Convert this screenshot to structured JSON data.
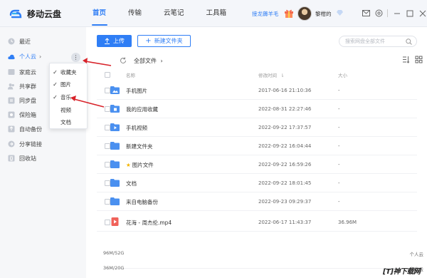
{
  "app": {
    "title": "移动云盘",
    "accent_color": "#2f7ef5",
    "nav_tabs": [
      {
        "label": "首页",
        "active": true
      },
      {
        "label": "传输",
        "active": false
      },
      {
        "label": "云笔记",
        "active": false
      },
      {
        "label": "工具箱",
        "active": false
      }
    ],
    "promo_text": "接龙薅羊毛",
    "username": "黎柑的",
    "top_icons": [
      "mail-icon",
      "settings-icon",
      "minimize-icon",
      "maximize-icon",
      "close-icon"
    ]
  },
  "sidebar": {
    "items": [
      {
        "label": "最近",
        "icon": "clock-icon"
      },
      {
        "label": "个人云",
        "icon": "cloud-icon",
        "active": true
      },
      {
        "label": "家庭云",
        "icon": "home-icon"
      },
      {
        "label": "共享群",
        "icon": "group-icon"
      },
      {
        "label": "同步盘",
        "icon": "sync-icon"
      },
      {
        "label": "保险箱",
        "icon": "safe-icon"
      },
      {
        "label": "自动备份",
        "icon": "backup-icon"
      },
      {
        "label": "分享链接",
        "icon": "share-icon"
      },
      {
        "label": "回收站",
        "icon": "trash-icon"
      }
    ],
    "storage": [
      {
        "used": "96M/52G",
        "label": "个人云",
        "fraction": 0.02
      },
      {
        "used": "36M/20G",
        "label": "家庭云",
        "fraction": 0.02
      }
    ]
  },
  "context_menu": {
    "items": [
      {
        "label": "收藏夹",
        "checked": true
      },
      {
        "label": "图片",
        "checked": true
      },
      {
        "label": "音乐",
        "checked": true
      },
      {
        "label": "视频",
        "checked": false
      },
      {
        "label": "文档",
        "checked": false
      }
    ]
  },
  "toolbar": {
    "upload_label": "上传",
    "new_folder_label": "新建文件夹",
    "search_placeholder": "搜索网盘全部文件"
  },
  "breadcrumb": {
    "label": "全部文件"
  },
  "table": {
    "headers": {
      "name": "名称",
      "modified": "修改时间",
      "size": "大小"
    },
    "rows": [
      {
        "name": "手机图片",
        "date": "2017-06-16 21:10:36",
        "size": "-",
        "type": "folder-image"
      },
      {
        "name": "我的应用收藏",
        "date": "2022-08-31 22:27:46",
        "size": "-",
        "type": "folder-app"
      },
      {
        "name": "手机视频",
        "date": "2022-09-22 17:37:57",
        "size": "-",
        "type": "folder-video"
      },
      {
        "name": "新建文件夹",
        "date": "2022-09-22 16:04:44",
        "size": "-",
        "type": "folder"
      },
      {
        "name": "图片文件",
        "date": "2022-09-22 16:59:26",
        "size": "-",
        "type": "folder",
        "starred": true
      },
      {
        "name": "文档",
        "date": "2022-09-22 18:01:45",
        "size": "-",
        "type": "folder"
      },
      {
        "name": "来自电脑备份",
        "date": "2022-09-23 09:29:37",
        "size": "-",
        "type": "folder"
      },
      {
        "name": "花海 - 周杰伦.mp4",
        "date": "2022-06-17 11:43:37",
        "size": "36.96M",
        "type": "video-file"
      }
    ]
  },
  "watermark": "[T]神下载网"
}
